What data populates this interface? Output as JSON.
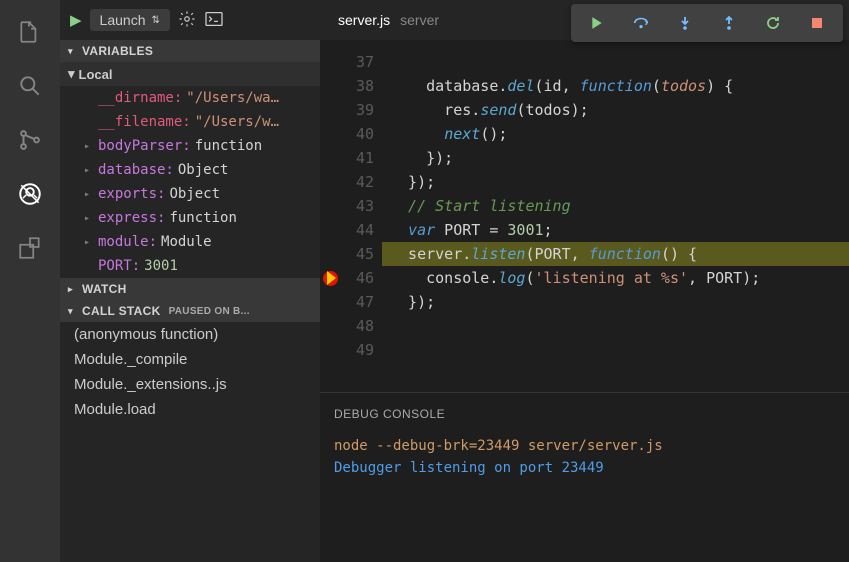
{
  "activityBar": {
    "items": [
      {
        "name": "explorer-icon"
      },
      {
        "name": "search-icon"
      },
      {
        "name": "git-icon"
      },
      {
        "name": "debug-icon",
        "active": true
      },
      {
        "name": "extensions-icon"
      }
    ]
  },
  "debugHead": {
    "launchLabel": "Launch"
  },
  "sections": {
    "variables": "VARIABLES",
    "local": "Local",
    "watch": "WATCH",
    "callstack": "CALL STACK",
    "pausedBadge": "PAUSED ON B..."
  },
  "variables": [
    {
      "name": "__dirname:",
      "value": "\"/Users/wa…",
      "special": true,
      "type": "str",
      "expandable": false
    },
    {
      "name": "__filename:",
      "value": "\"/Users/w…",
      "special": true,
      "type": "str",
      "expandable": false
    },
    {
      "name": "bodyParser:",
      "value": "function",
      "type": "id",
      "expandable": true
    },
    {
      "name": "database:",
      "value": "Object",
      "type": "id",
      "expandable": true
    },
    {
      "name": "exports:",
      "value": "Object",
      "type": "id",
      "expandable": true
    },
    {
      "name": "express:",
      "value": "function",
      "type": "id",
      "expandable": true
    },
    {
      "name": "module:",
      "value": "Module",
      "type": "id",
      "expandable": true
    },
    {
      "name": "PORT:",
      "value": "3001",
      "type": "num",
      "expandable": false
    }
  ],
  "callstack": [
    "(anonymous function)",
    "Module._compile",
    "Module._extensions..js",
    "Module.load"
  ],
  "editor": {
    "filename": "server.js",
    "folder": "server",
    "startLine": 37,
    "highlightLine": 46,
    "lines": [
      {
        "n": 37,
        "seg": [
          {
            "t": "    "
          }
        ]
      },
      {
        "n": 38,
        "seg": [
          {
            "t": "    database",
            "c": "id"
          },
          {
            "t": ".",
            "c": "id"
          },
          {
            "t": "del",
            "c": "fn"
          },
          {
            "t": "(id, ",
            "c": "id"
          },
          {
            "t": "function",
            "c": "kw"
          },
          {
            "t": "(",
            "c": "id"
          },
          {
            "t": "todos",
            "c": "param"
          },
          {
            "t": ") {",
            "c": "id"
          }
        ]
      },
      {
        "n": 39,
        "seg": [
          {
            "t": "      res",
            "c": "id"
          },
          {
            "t": ".",
            "c": "id"
          },
          {
            "t": "send",
            "c": "fn"
          },
          {
            "t": "(todos);",
            "c": "id"
          }
        ]
      },
      {
        "n": 40,
        "seg": [
          {
            "t": "      ",
            "c": "id"
          },
          {
            "t": "next",
            "c": "fn"
          },
          {
            "t": "();",
            "c": "id"
          }
        ]
      },
      {
        "n": 41,
        "seg": [
          {
            "t": "    });",
            "c": "id"
          }
        ]
      },
      {
        "n": 42,
        "seg": [
          {
            "t": "  });",
            "c": "id"
          }
        ]
      },
      {
        "n": 43,
        "seg": [
          {
            "t": ""
          }
        ]
      },
      {
        "n": 44,
        "seg": [
          {
            "t": "  // Start listening",
            "c": "cm"
          }
        ]
      },
      {
        "n": 45,
        "seg": [
          {
            "t": "  "
          },
          {
            "t": "var",
            "c": "kw"
          },
          {
            "t": " PORT = ",
            "c": "id"
          },
          {
            "t": "3001",
            "c": "num"
          },
          {
            "t": ";",
            "c": "id"
          }
        ]
      },
      {
        "n": 46,
        "seg": [
          {
            "t": "  server",
            "c": "id"
          },
          {
            "t": ".",
            "c": "id"
          },
          {
            "t": "listen",
            "c": "fn"
          },
          {
            "t": "(PORT, ",
            "c": "id"
          },
          {
            "t": "function",
            "c": "kw"
          },
          {
            "t": "() {",
            "c": "id"
          }
        ]
      },
      {
        "n": 47,
        "seg": [
          {
            "t": "    console",
            "c": "id"
          },
          {
            "t": ".",
            "c": "id"
          },
          {
            "t": "log",
            "c": "fn"
          },
          {
            "t": "(",
            "c": "id"
          },
          {
            "t": "'listening at %s'",
            "c": "str"
          },
          {
            "t": ", PORT);",
            "c": "id"
          }
        ]
      },
      {
        "n": 48,
        "seg": [
          {
            "t": "  });",
            "c": "id"
          }
        ]
      },
      {
        "n": 49,
        "seg": [
          {
            "t": ""
          }
        ]
      }
    ]
  },
  "console": {
    "title": "DEBUG CONSOLE",
    "lines": [
      {
        "text": "node --debug-brk=23449 server/server.js",
        "type": "cmd"
      },
      {
        "text": "Debugger listening on port 23449",
        "type": "out"
      }
    ]
  }
}
